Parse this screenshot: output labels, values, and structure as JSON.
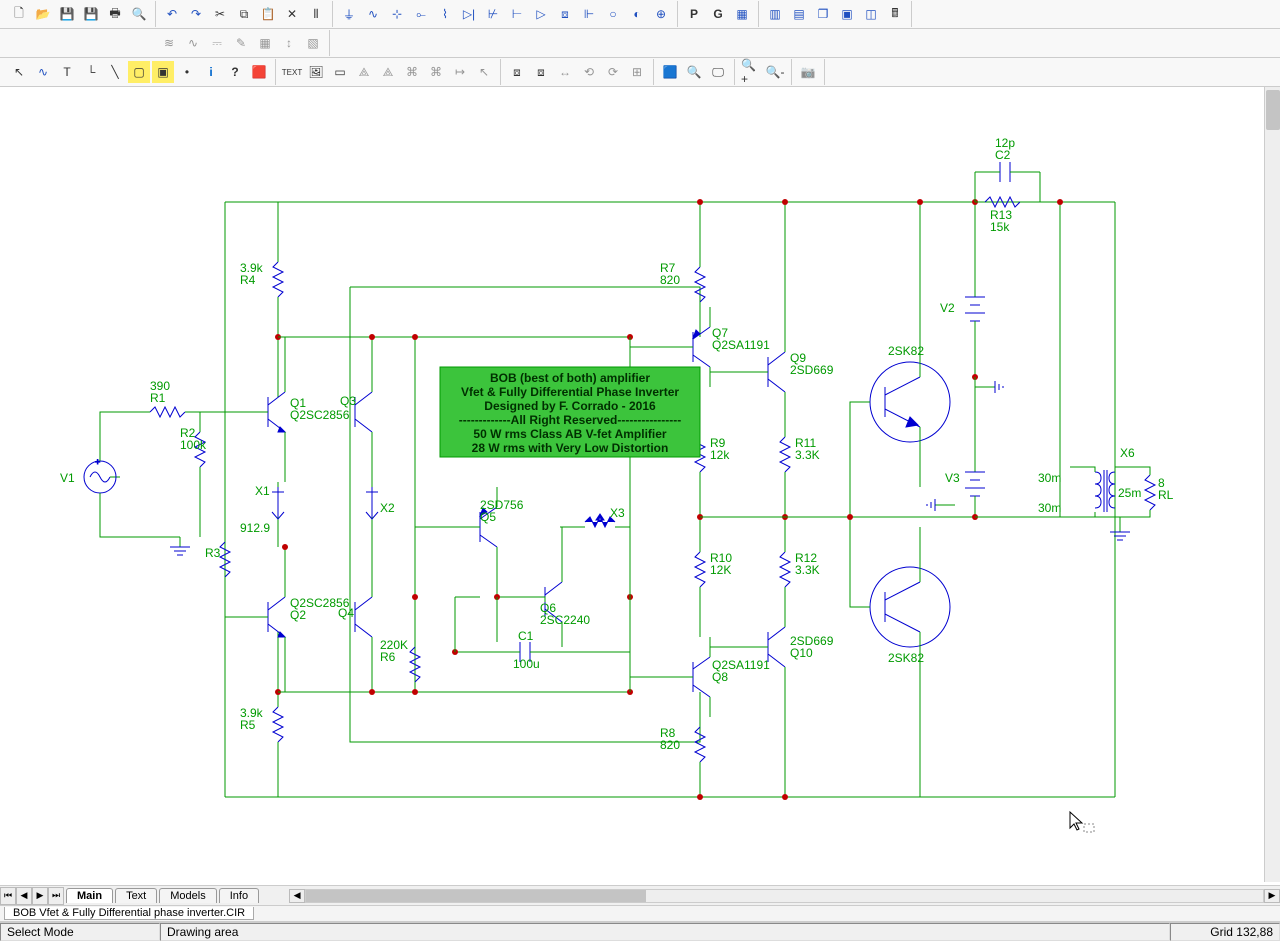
{
  "toolbar1": {
    "file": [
      "new",
      "open",
      "save",
      "save-all",
      "print",
      "print-preview"
    ],
    "edit": [
      "undo",
      "redo",
      "cut",
      "copy",
      "paste",
      "delete",
      "macro"
    ],
    "components": [
      "ground",
      "sine",
      "resistor",
      "cap-plus",
      "inductor",
      "diode",
      "npn",
      "jfet",
      "opamp",
      "xfmr",
      "mosfet",
      "source",
      "junction",
      "annotate"
    ],
    "letters": {
      "P": "P",
      "G": "G"
    },
    "view": [
      "grid",
      "tile-h",
      "tile-v",
      "cascade",
      "maximize",
      "window",
      "calc"
    ]
  },
  "toolbar2": {
    "analysis": [
      "tran",
      "ac",
      "dc",
      "noise",
      "dist",
      "sense",
      "sweep",
      "monte"
    ]
  },
  "toolbar3": {
    "mode": [
      "select",
      "wire",
      "text",
      "bus",
      "net",
      "box",
      "gnd",
      "flag",
      "info",
      "whatsthis",
      "rgb",
      "txtbox",
      "img1",
      "img2",
      "obj1",
      "obj2",
      "opt1",
      "opt2",
      "opt3",
      "link",
      "arrow",
      "del",
      "gbox",
      "gbox2",
      "eq",
      "r1",
      "r2",
      "r3",
      "r4",
      "chip",
      "find",
      "disp",
      "zoom-in",
      "zoom-out",
      "cam"
    ]
  },
  "tabs": [
    {
      "label": "Main",
      "active": true
    },
    {
      "label": "Text",
      "active": false
    },
    {
      "label": "Models",
      "active": false
    },
    {
      "label": "Info",
      "active": false
    }
  ],
  "file_row": {
    "filename": "BOB Vfet & Fully Differential phase inverter.CIR"
  },
  "status": {
    "mode": "Select Mode",
    "area": "Drawing area",
    "grid": "Grid 132,88"
  },
  "schematic": {
    "title": [
      "BOB (best of both) amplifier",
      "Vfet & Fully Differential Phase Inverter",
      "Designed by F. Corrado - 2016",
      "-------------All Right Reserved----------------",
      "50 W rms Class AB V-fet Amplifier",
      "28 W rms  with Very Low Distortion"
    ],
    "labels": {
      "V1": "V1",
      "R1": "390\nR1",
      "R2": "R2\n100k",
      "R3": "R3",
      "R4": "3.9k\nR4",
      "R5": "3.9k\nR5",
      "Q1": "Q1\nQ2SC2856",
      "Q2": "Q2SC2856\nQ2",
      "Q3": "Q3",
      "Q4": "Q4",
      "X1": "X1",
      "X2": "X2",
      "R6": "220K\nR6",
      "R7": "R7\n820",
      "R8": "R8\n820",
      "Q5": "2SD756\nQ5",
      "X3": "X3",
      "Q6": "Q6\n2SC2240",
      "C1": "C1\n100u",
      "Q7": "Q7\nQ2SA1191",
      "Q8": "Q2SA1191\nQ8",
      "Q9": "Q9\n2SD669",
      "Q10": "2SD669\nQ10",
      "R9": "R9\n12k",
      "R10": "R10\n12K",
      "R11": "R11\n3.3K",
      "R12": "R12\n3.3K",
      "T1": "2SK82",
      "T2": "2SK82",
      "V2": "V2",
      "V3": "V3",
      "C2": "12p\nC2",
      "R13": "R13\n15k",
      "X6": "X6",
      "XW1": "30m",
      "XW2": "30m",
      "XW3": "25m",
      "RL": "8\nRL",
      "X1v": "912.9"
    }
  }
}
